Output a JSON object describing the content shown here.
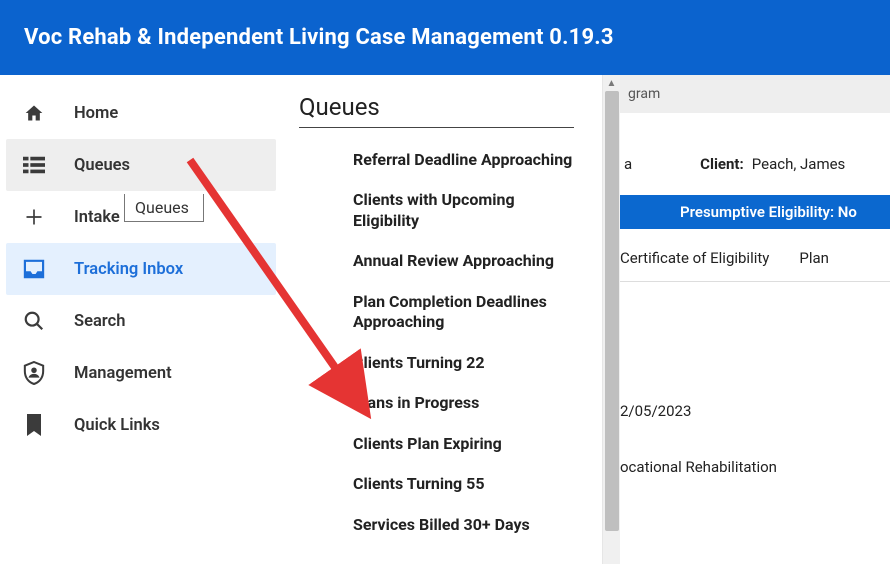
{
  "header": {
    "title": "Voc Rehab & Independent Living Case Management 0.19.3"
  },
  "sidebar": {
    "items": [
      {
        "label": "Home"
      },
      {
        "label": "Queues"
      },
      {
        "label": "Intake"
      },
      {
        "label": "Tracking Inbox"
      },
      {
        "label": "Search"
      },
      {
        "label": "Management"
      },
      {
        "label": "Quick Links"
      }
    ],
    "tooltip": "Queues"
  },
  "queues_panel": {
    "title": "Queues",
    "items": [
      "Referral Deadline Approaching",
      "Clients with Upcoming Eligibility",
      "Annual Review Approaching",
      "Plan Completion Deadlines Approaching",
      "Clients Turning 22",
      "Plans in Progress",
      "Clients Plan Expiring",
      "Clients Turning 55",
      "Services Billed 30+ Days"
    ]
  },
  "main": {
    "breadcrumb_fragment": "gram",
    "row_info": [
      {
        "label_fragment": "a"
      },
      {
        "label": "Client:",
        "value": "Peach, James"
      }
    ],
    "blue_bar_text": "Presumptive Eligibility: No",
    "tabs": [
      {
        "label": "Certificate of Eligibility"
      },
      {
        "label": "Plan"
      }
    ],
    "fields": [
      {
        "value_fragment": "2/05/2023"
      },
      {
        "value_fragment": "ocational Rehabilitation"
      }
    ]
  }
}
